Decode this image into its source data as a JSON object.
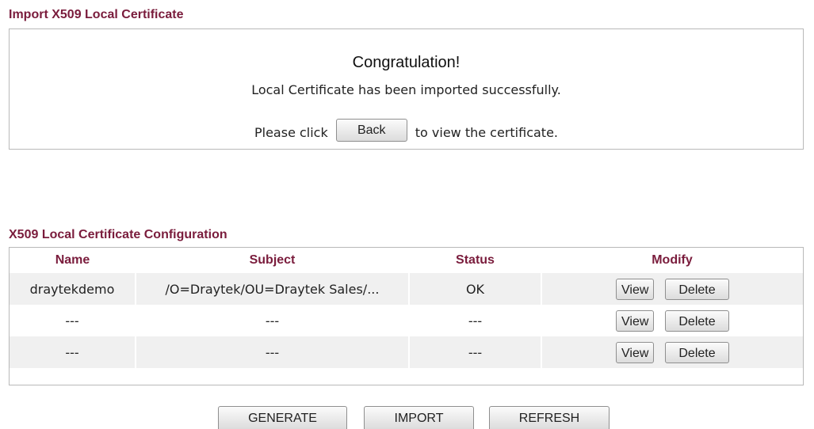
{
  "import_section": {
    "title": "Import X509 Local Certificate",
    "heading": "Congratulation!",
    "message": "Local Certificate has been imported successfully.",
    "prompt_before": "Please click",
    "back_label": "Back",
    "prompt_after": "to view the certificate."
  },
  "config_section": {
    "title": "X509 Local Certificate Configuration",
    "columns": [
      "Name",
      "Subject",
      "Status",
      "Modify"
    ],
    "rows": [
      {
        "name": "draytekdemo",
        "subject": "/O=Draytek/OU=Draytek Sales/...",
        "status": "OK"
      },
      {
        "name": "---",
        "subject": "---",
        "status": "---"
      },
      {
        "name": "---",
        "subject": "---",
        "status": "---"
      }
    ],
    "view_label": "View",
    "delete_label": "Delete"
  },
  "actions": {
    "generate_label": "GENERATE",
    "import_label": "IMPORT",
    "refresh_label": "REFRESH"
  },
  "colors": {
    "section_title": "#7a1c3c",
    "row_shade": "#f0f0f0",
    "border": "#b9b9b9"
  }
}
